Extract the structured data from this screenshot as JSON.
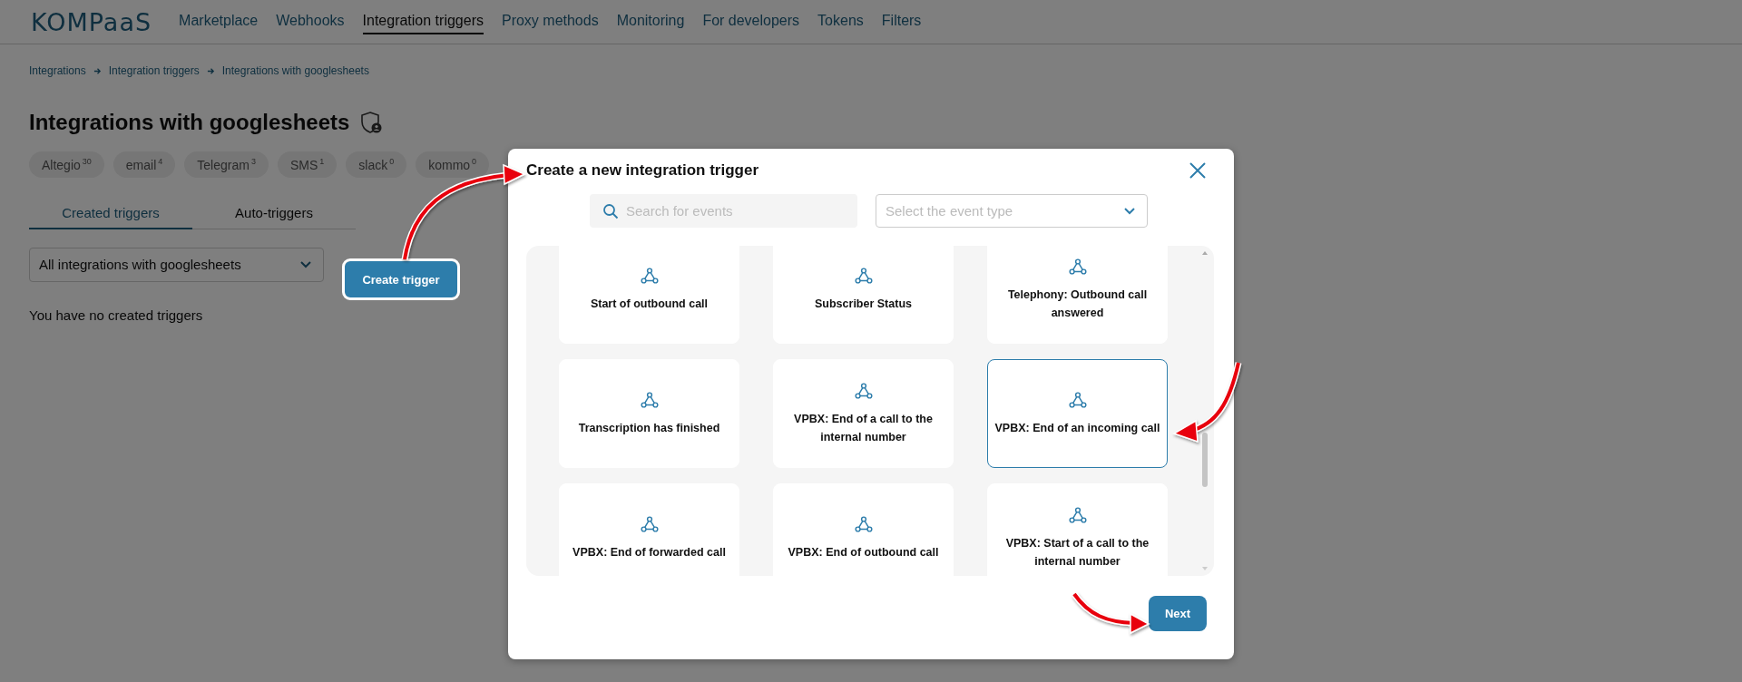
{
  "logo": "KOMPaaS",
  "nav": [
    {
      "label": "Marketplace",
      "selected": false
    },
    {
      "label": "Webhooks",
      "selected": false
    },
    {
      "label": "Integration triggers",
      "selected": true
    },
    {
      "label": "Proxy methods",
      "selected": false
    },
    {
      "label": "Monitoring",
      "selected": false
    },
    {
      "label": "For developers",
      "selected": false
    },
    {
      "label": "Tokens",
      "selected": false
    },
    {
      "label": "Filters",
      "selected": false
    }
  ],
  "breadcrumbs": [
    "Integrations",
    "Integration triggers",
    "Integrations with googlesheets"
  ],
  "title": "Integrations with googlesheets",
  "chips": [
    {
      "label": "Altegio",
      "count": "30"
    },
    {
      "label": "email",
      "count": "4"
    },
    {
      "label": "Telegram",
      "count": "3"
    },
    {
      "label": "SMS",
      "count": "1"
    },
    {
      "label": "slack",
      "count": "0"
    },
    {
      "label": "kommo",
      "count": "0"
    }
  ],
  "tabs": [
    {
      "label": "Created triggers",
      "selected": true
    },
    {
      "label": "Auto-triggers",
      "selected": false
    }
  ],
  "filter": {
    "value": "All integrations with googlesheets"
  },
  "create_button": "Create trigger",
  "empty_message": "You have no created triggers",
  "modal": {
    "title": "Create a new integration trigger",
    "search": {
      "placeholder": "Search for events"
    },
    "event_type": {
      "placeholder": "Select the event type"
    },
    "events": [
      {
        "label": "Start of outbound call",
        "selected": false
      },
      {
        "label": "Subscriber Status",
        "selected": false
      },
      {
        "label": "Telephony: Outbound call answered",
        "selected": false
      },
      {
        "label": "Transcription has finished",
        "selected": false
      },
      {
        "label": "VPBX: End of a call to the internal number",
        "selected": false
      },
      {
        "label": "VPBX: End of an incoming call",
        "selected": true
      },
      {
        "label": "VPBX: End of forwarded call",
        "selected": false
      },
      {
        "label": "VPBX: End of outbound call",
        "selected": false
      },
      {
        "label": "VPBX: Start of a call to the internal number",
        "selected": false
      }
    ],
    "next_button": "Next"
  }
}
